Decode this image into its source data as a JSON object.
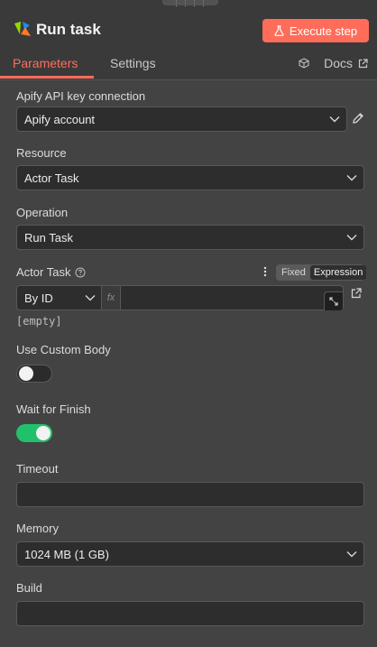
{
  "header": {
    "title": "Run task",
    "execute_label": "Execute step",
    "accent": "#ff6d5a"
  },
  "tabs": [
    {
      "label": "Parameters",
      "active": true
    },
    {
      "label": "Settings",
      "active": false
    }
  ],
  "docs": {
    "label": "Docs",
    "icon": "external-link-icon"
  },
  "fields": {
    "credential": {
      "label": "Apify API key connection",
      "value": "Apify account"
    },
    "resource": {
      "label": "Resource",
      "value": "Actor Task"
    },
    "operation": {
      "label": "Operation",
      "value": "Run Task"
    },
    "actor_task": {
      "label": "Actor Task",
      "mode_value": "By ID",
      "fx": "fx",
      "fixed_label": "Fixed",
      "expression_label": "Expression",
      "empty_hint": "[empty]"
    },
    "custom_body": {
      "label": "Use Custom Body",
      "on": false
    },
    "wait_finish": {
      "label": "Wait for Finish",
      "on": true,
      "on_color": "#21c16b"
    },
    "timeout": {
      "label": "Timeout",
      "value": ""
    },
    "memory": {
      "label": "Memory",
      "value": "1024 MB (1 GB)"
    },
    "build": {
      "label": "Build",
      "value": ""
    }
  }
}
